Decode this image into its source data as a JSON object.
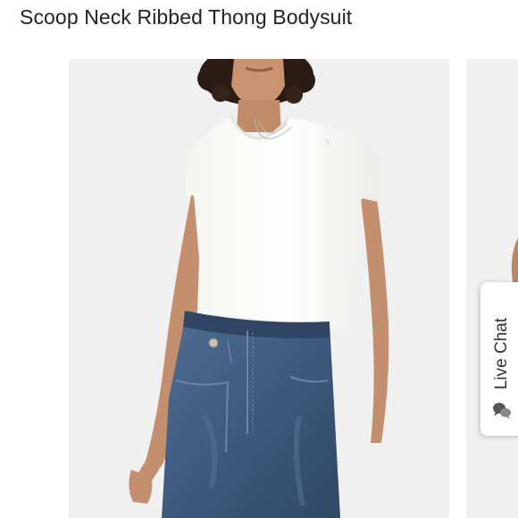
{
  "product": {
    "title": "Scoop Neck Ribbed Thong Bodysuit"
  },
  "gallery": {
    "main_image_icon": "model-photo-white-bodysuit-jeans",
    "next_image_icon": "next-photo-preview",
    "background_color": "#f0f0f1"
  },
  "live_chat": {
    "label": "Live Chat",
    "icon": "chat-bubbles-icon"
  },
  "colors": {
    "title_text": "#222222",
    "denim": "#3f5c80",
    "bodysuit": "#fbfbf8",
    "skin": "#c48f6e",
    "hair": "#2a1c14"
  }
}
